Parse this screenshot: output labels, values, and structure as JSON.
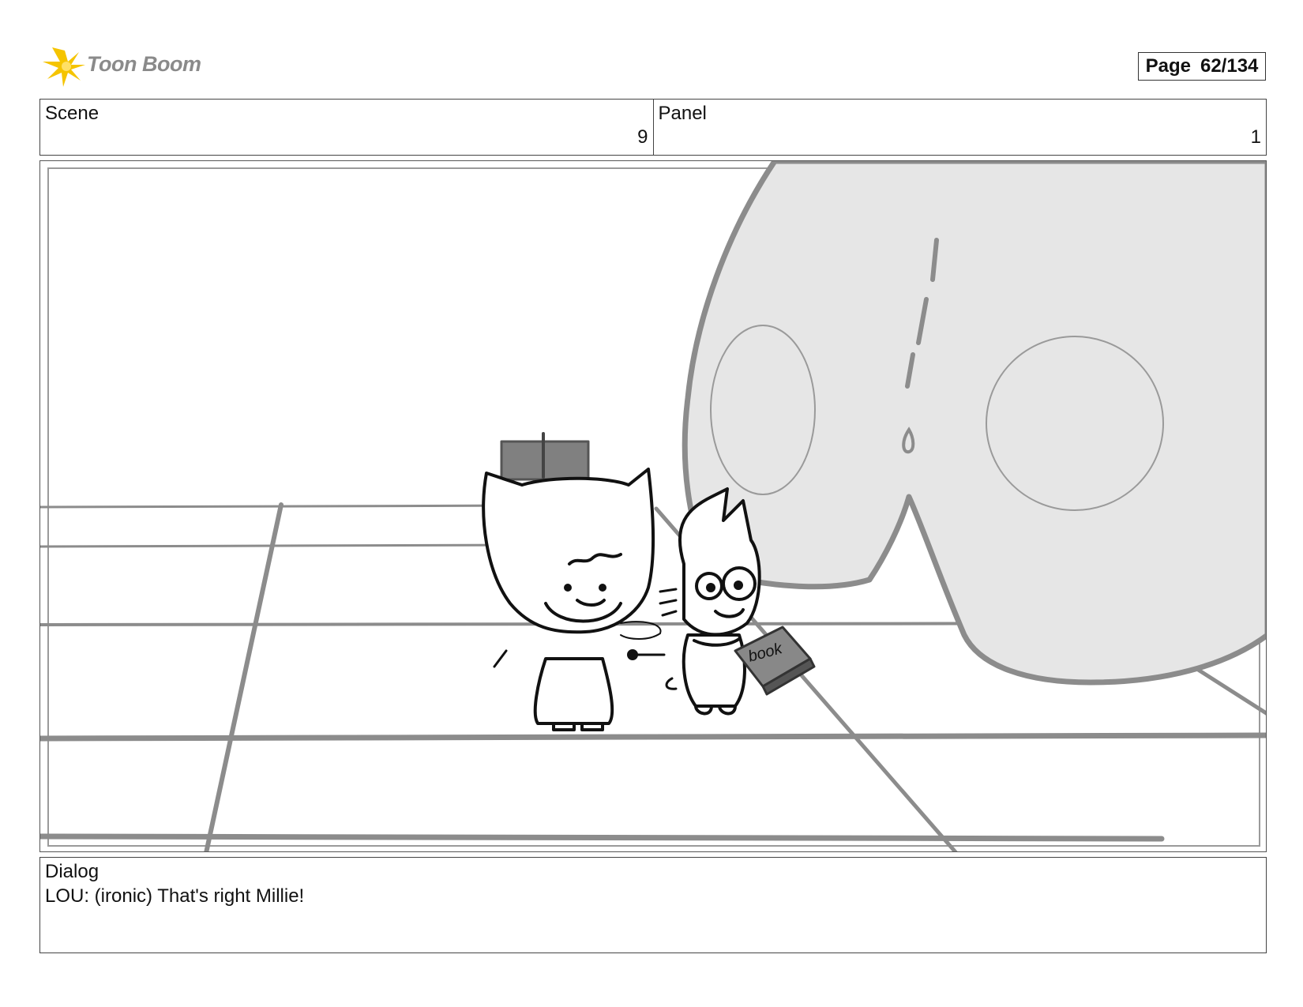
{
  "header": {
    "logo_text": "Toon Boom",
    "page_label": "Page",
    "page_number": "62/134"
  },
  "info": {
    "scene_label": "Scene",
    "scene_value": "9",
    "panel_label": "Panel",
    "panel_value": "1"
  },
  "panel": {
    "book_text": "book"
  },
  "dialog": {
    "label": "Dialog",
    "text": "LOU: (ironic) That's right Millie!"
  },
  "colors": {
    "logo_accent": "#f5c400",
    "giant_fill": "#e6e6e6",
    "stroke_gray": "#8c8c8c"
  }
}
